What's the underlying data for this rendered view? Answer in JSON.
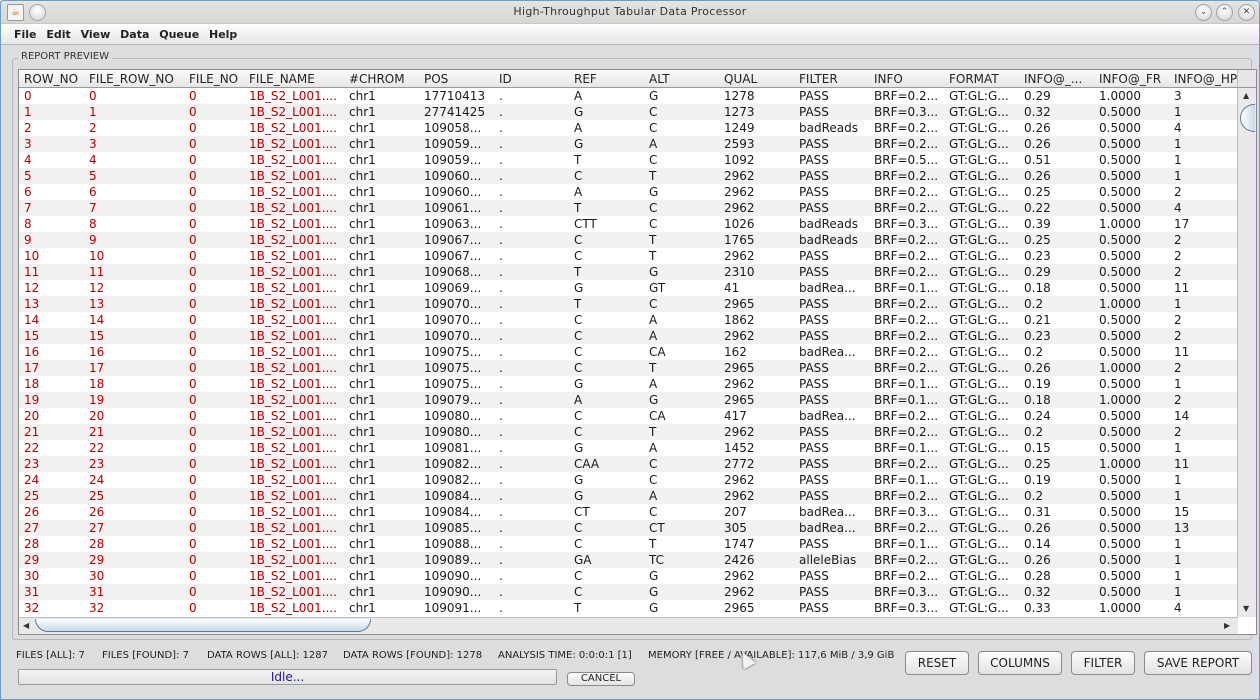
{
  "window": {
    "title": "High-Throughput Tabular Data Processor",
    "controls": [
      "minimize-icon",
      "maximize-icon",
      "close-icon"
    ]
  },
  "menu": [
    "File",
    "Edit",
    "View",
    "Data",
    "Queue",
    "Help"
  ],
  "group_label": "REPORT PREVIEW",
  "table": {
    "columns": [
      "ROW_NO",
      "FILE_ROW_NO",
      "FILE_NO",
      "FILE_NAME",
      "#CHROM",
      "POS",
      "ID",
      "REF",
      "ALT",
      "QUAL",
      "FILTER",
      "INFO",
      "FORMAT",
      "INFO@_...",
      "INFO@_FR",
      "INFO@_HP"
    ],
    "highlight_color": "#b40000",
    "rows": [
      [
        "0",
        "0",
        "0",
        "1B_S2_L001....",
        "chr1",
        "17710413",
        ".",
        "A",
        "G",
        "1278",
        "PASS",
        "BRF=0.2...",
        "GT:GL:G...",
        "0.29",
        "1.0000",
        "3"
      ],
      [
        "1",
        "1",
        "0",
        "1B_S2_L001....",
        "chr1",
        "27741425",
        ".",
        "G",
        "C",
        "1273",
        "PASS",
        "BRF=0.3...",
        "GT:GL:G...",
        "0.32",
        "0.5000",
        "1"
      ],
      [
        "2",
        "2",
        "0",
        "1B_S2_L001....",
        "chr1",
        "109058...",
        ".",
        "A",
        "C",
        "1249",
        "badReads",
        "BRF=0.2...",
        "GT:GL:G...",
        "0.26",
        "0.5000",
        "4"
      ],
      [
        "3",
        "3",
        "0",
        "1B_S2_L001....",
        "chr1",
        "109059...",
        ".",
        "G",
        "A",
        "2593",
        "PASS",
        "BRF=0.2...",
        "GT:GL:G...",
        "0.26",
        "0.5000",
        "1"
      ],
      [
        "4",
        "4",
        "0",
        "1B_S2_L001....",
        "chr1",
        "109059...",
        ".",
        "T",
        "C",
        "1092",
        "PASS",
        "BRF=0.5...",
        "GT:GL:G...",
        "0.51",
        "0.5000",
        "1"
      ],
      [
        "5",
        "5",
        "0",
        "1B_S2_L001....",
        "chr1",
        "109060...",
        ".",
        "C",
        "T",
        "2962",
        "PASS",
        "BRF=0.2...",
        "GT:GL:G...",
        "0.26",
        "0.5000",
        "1"
      ],
      [
        "6",
        "6",
        "0",
        "1B_S2_L001....",
        "chr1",
        "109060...",
        ".",
        "A",
        "G",
        "2962",
        "PASS",
        "BRF=0.2...",
        "GT:GL:G...",
        "0.25",
        "0.5000",
        "2"
      ],
      [
        "7",
        "7",
        "0",
        "1B_S2_L001....",
        "chr1",
        "109061...",
        ".",
        "T",
        "C",
        "2962",
        "PASS",
        "BRF=0.2...",
        "GT:GL:G...",
        "0.22",
        "0.5000",
        "4"
      ],
      [
        "8",
        "8",
        "0",
        "1B_S2_L001....",
        "chr1",
        "109063...",
        ".",
        "CTT",
        "C",
        "1026",
        "badReads",
        "BRF=0.3...",
        "GT:GL:G...",
        "0.39",
        "1.0000",
        "17"
      ],
      [
        "9",
        "9",
        "0",
        "1B_S2_L001....",
        "chr1",
        "109067...",
        ".",
        "C",
        "T",
        "1765",
        "badReads",
        "BRF=0.2...",
        "GT:GL:G...",
        "0.25",
        "0.5000",
        "2"
      ],
      [
        "10",
        "10",
        "0",
        "1B_S2_L001....",
        "chr1",
        "109067...",
        ".",
        "C",
        "T",
        "2962",
        "PASS",
        "BRF=0.2...",
        "GT:GL:G...",
        "0.23",
        "0.5000",
        "2"
      ],
      [
        "11",
        "11",
        "0",
        "1B_S2_L001....",
        "chr1",
        "109068...",
        ".",
        "T",
        "G",
        "2310",
        "PASS",
        "BRF=0.2...",
        "GT:GL:G...",
        "0.29",
        "0.5000",
        "2"
      ],
      [
        "12",
        "12",
        "0",
        "1B_S2_L001....",
        "chr1",
        "109069...",
        ".",
        "G",
        "GT",
        "41",
        "badRea...",
        "BRF=0.1...",
        "GT:GL:G...",
        "0.18",
        "0.5000",
        "11"
      ],
      [
        "13",
        "13",
        "0",
        "1B_S2_L001....",
        "chr1",
        "109070...",
        ".",
        "T",
        "C",
        "2965",
        "PASS",
        "BRF=0.2...",
        "GT:GL:G...",
        "0.2",
        "1.0000",
        "1"
      ],
      [
        "14",
        "14",
        "0",
        "1B_S2_L001....",
        "chr1",
        "109070...",
        ".",
        "C",
        "A",
        "1862",
        "PASS",
        "BRF=0.2...",
        "GT:GL:G...",
        "0.21",
        "0.5000",
        "2"
      ],
      [
        "15",
        "15",
        "0",
        "1B_S2_L001....",
        "chr1",
        "109070...",
        ".",
        "C",
        "A",
        "2962",
        "PASS",
        "BRF=0.2...",
        "GT:GL:G...",
        "0.23",
        "0.5000",
        "2"
      ],
      [
        "16",
        "16",
        "0",
        "1B_S2_L001....",
        "chr1",
        "109075...",
        ".",
        "C",
        "CA",
        "162",
        "badRea...",
        "BRF=0.2...",
        "GT:GL:G...",
        "0.2",
        "0.5000",
        "11"
      ],
      [
        "17",
        "17",
        "0",
        "1B_S2_L001....",
        "chr1",
        "109075...",
        ".",
        "C",
        "T",
        "2965",
        "PASS",
        "BRF=0.2...",
        "GT:GL:G...",
        "0.26",
        "1.0000",
        "2"
      ],
      [
        "18",
        "18",
        "0",
        "1B_S2_L001....",
        "chr1",
        "109075...",
        ".",
        "G",
        "A",
        "2962",
        "PASS",
        "BRF=0.1...",
        "GT:GL:G...",
        "0.19",
        "0.5000",
        "1"
      ],
      [
        "19",
        "19",
        "0",
        "1B_S2_L001....",
        "chr1",
        "109079...",
        ".",
        "A",
        "G",
        "2965",
        "PASS",
        "BRF=0.1...",
        "GT:GL:G...",
        "0.18",
        "1.0000",
        "2"
      ],
      [
        "20",
        "20",
        "0",
        "1B_S2_L001....",
        "chr1",
        "109080...",
        ".",
        "C",
        "CA",
        "417",
        "badRea...",
        "BRF=0.2...",
        "GT:GL:G...",
        "0.24",
        "0.5000",
        "14"
      ],
      [
        "21",
        "21",
        "0",
        "1B_S2_L001....",
        "chr1",
        "109080...",
        ".",
        "C",
        "T",
        "2962",
        "PASS",
        "BRF=0.2...",
        "GT:GL:G...",
        "0.2",
        "0.5000",
        "2"
      ],
      [
        "22",
        "22",
        "0",
        "1B_S2_L001....",
        "chr1",
        "109081...",
        ".",
        "G",
        "A",
        "1452",
        "PASS",
        "BRF=0.1...",
        "GT:GL:G...",
        "0.15",
        "0.5000",
        "1"
      ],
      [
        "23",
        "23",
        "0",
        "1B_S2_L001....",
        "chr1",
        "109082...",
        ".",
        "CAA",
        "C",
        "2772",
        "PASS",
        "BRF=0.2...",
        "GT:GL:G...",
        "0.25",
        "1.0000",
        "11"
      ],
      [
        "24",
        "24",
        "0",
        "1B_S2_L001....",
        "chr1",
        "109082...",
        ".",
        "G",
        "C",
        "2962",
        "PASS",
        "BRF=0.1...",
        "GT:GL:G...",
        "0.19",
        "0.5000",
        "1"
      ],
      [
        "25",
        "25",
        "0",
        "1B_S2_L001....",
        "chr1",
        "109084...",
        ".",
        "G",
        "A",
        "2962",
        "PASS",
        "BRF=0.2...",
        "GT:GL:G...",
        "0.2",
        "0.5000",
        "1"
      ],
      [
        "26",
        "26",
        "0",
        "1B_S2_L001....",
        "chr1",
        "109084...",
        ".",
        "CT",
        "C",
        "207",
        "badRea...",
        "BRF=0.3...",
        "GT:GL:G...",
        "0.31",
        "0.5000",
        "15"
      ],
      [
        "27",
        "27",
        "0",
        "1B_S2_L001....",
        "chr1",
        "109085...",
        ".",
        "C",
        "CT",
        "305",
        "badRea...",
        "BRF=0.2...",
        "GT:GL:G...",
        "0.26",
        "0.5000",
        "13"
      ],
      [
        "28",
        "28",
        "0",
        "1B_S2_L001....",
        "chr1",
        "109088...",
        ".",
        "C",
        "T",
        "1747",
        "PASS",
        "BRF=0.1...",
        "GT:GL:G...",
        "0.14",
        "0.5000",
        "1"
      ],
      [
        "29",
        "29",
        "0",
        "1B_S2_L001....",
        "chr1",
        "109089...",
        ".",
        "GA",
        "TC",
        "2426",
        "alleleBias",
        "BRF=0.2...",
        "GT:GL:G...",
        "0.26",
        "0.5000",
        "1"
      ],
      [
        "30",
        "30",
        "0",
        "1B_S2_L001....",
        "chr1",
        "109090...",
        ".",
        "C",
        "G",
        "2962",
        "PASS",
        "BRF=0.2...",
        "GT:GL:G...",
        "0.28",
        "0.5000",
        "1"
      ],
      [
        "31",
        "31",
        "0",
        "1B_S2_L001....",
        "chr1",
        "109090...",
        ".",
        "C",
        "G",
        "2962",
        "PASS",
        "BRF=0.3...",
        "GT:GL:G...",
        "0.32",
        "0.5000",
        "1"
      ],
      [
        "32",
        "32",
        "0",
        "1B_S2_L001....",
        "chr1",
        "109091...",
        ".",
        "T",
        "G",
        "2965",
        "PASS",
        "BRF=0.3...",
        "GT:GL:G...",
        "0.33",
        "1.0000",
        "4"
      ]
    ]
  },
  "status": {
    "files_all": "FILES [ALL]: 7",
    "files_found": "FILES [FOUND]: 7",
    "rows_all": "DATA ROWS [ALL]: 1287",
    "rows_found": "DATA ROWS [FOUND]: 1278",
    "analysis_time": "ANALYSIS TIME: 0:0:0:1 [1]",
    "memory": "MEMORY [FREE / AVAILABLE]: 117,6 MiB / 3,9 GiB"
  },
  "progress": {
    "label": "Idle...",
    "value": 0
  },
  "buttons": {
    "cancel": "CANCEL",
    "reset": "RESET",
    "columns": "COLUMNS",
    "filter": "FILTER",
    "save_report": "SAVE REPORT"
  }
}
